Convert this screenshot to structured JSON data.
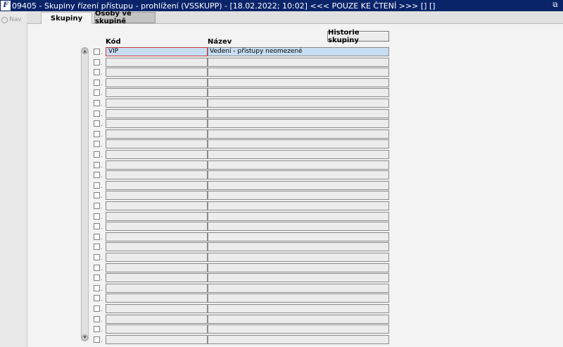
{
  "window": {
    "title": "09405 - Skupiny řízení přístupu - prohlížení (VSSKUPP) - [18.02.2022; 10:02] <<< POUZE KE ČTENÍ >>>  [] []"
  },
  "nav": {
    "label": "Nav"
  },
  "tabs": [
    {
      "label": "Skupiny"
    },
    {
      "label": "Osoby ve skupině"
    }
  ],
  "toolbar": {
    "history_label": "Historie skupiny"
  },
  "table": {
    "columns": [
      "Kód",
      "Název"
    ],
    "rows": [
      {
        "kod": "VIP",
        "nazev": "Vedení - přístupy neomezené"
      },
      {
        "kod": "",
        "nazev": ""
      },
      {
        "kod": "",
        "nazev": ""
      },
      {
        "kod": "",
        "nazev": ""
      },
      {
        "kod": "",
        "nazev": ""
      },
      {
        "kod": "",
        "nazev": ""
      },
      {
        "kod": "",
        "nazev": ""
      },
      {
        "kod": "",
        "nazev": ""
      },
      {
        "kod": "",
        "nazev": ""
      },
      {
        "kod": "",
        "nazev": ""
      },
      {
        "kod": "",
        "nazev": ""
      },
      {
        "kod": "",
        "nazev": ""
      },
      {
        "kod": "",
        "nazev": ""
      },
      {
        "kod": "",
        "nazev": ""
      },
      {
        "kod": "",
        "nazev": ""
      },
      {
        "kod": "",
        "nazev": ""
      },
      {
        "kod": "",
        "nazev": ""
      },
      {
        "kod": "",
        "nazev": ""
      },
      {
        "kod": "",
        "nazev": ""
      },
      {
        "kod": "",
        "nazev": ""
      },
      {
        "kod": "",
        "nazev": ""
      },
      {
        "kod": "",
        "nazev": ""
      },
      {
        "kod": "",
        "nazev": ""
      },
      {
        "kod": "",
        "nazev": ""
      },
      {
        "kod": "",
        "nazev": ""
      },
      {
        "kod": "",
        "nazev": ""
      },
      {
        "kod": "",
        "nazev": ""
      },
      {
        "kod": "",
        "nazev": ""
      },
      {
        "kod": "",
        "nazev": ""
      }
    ]
  }
}
